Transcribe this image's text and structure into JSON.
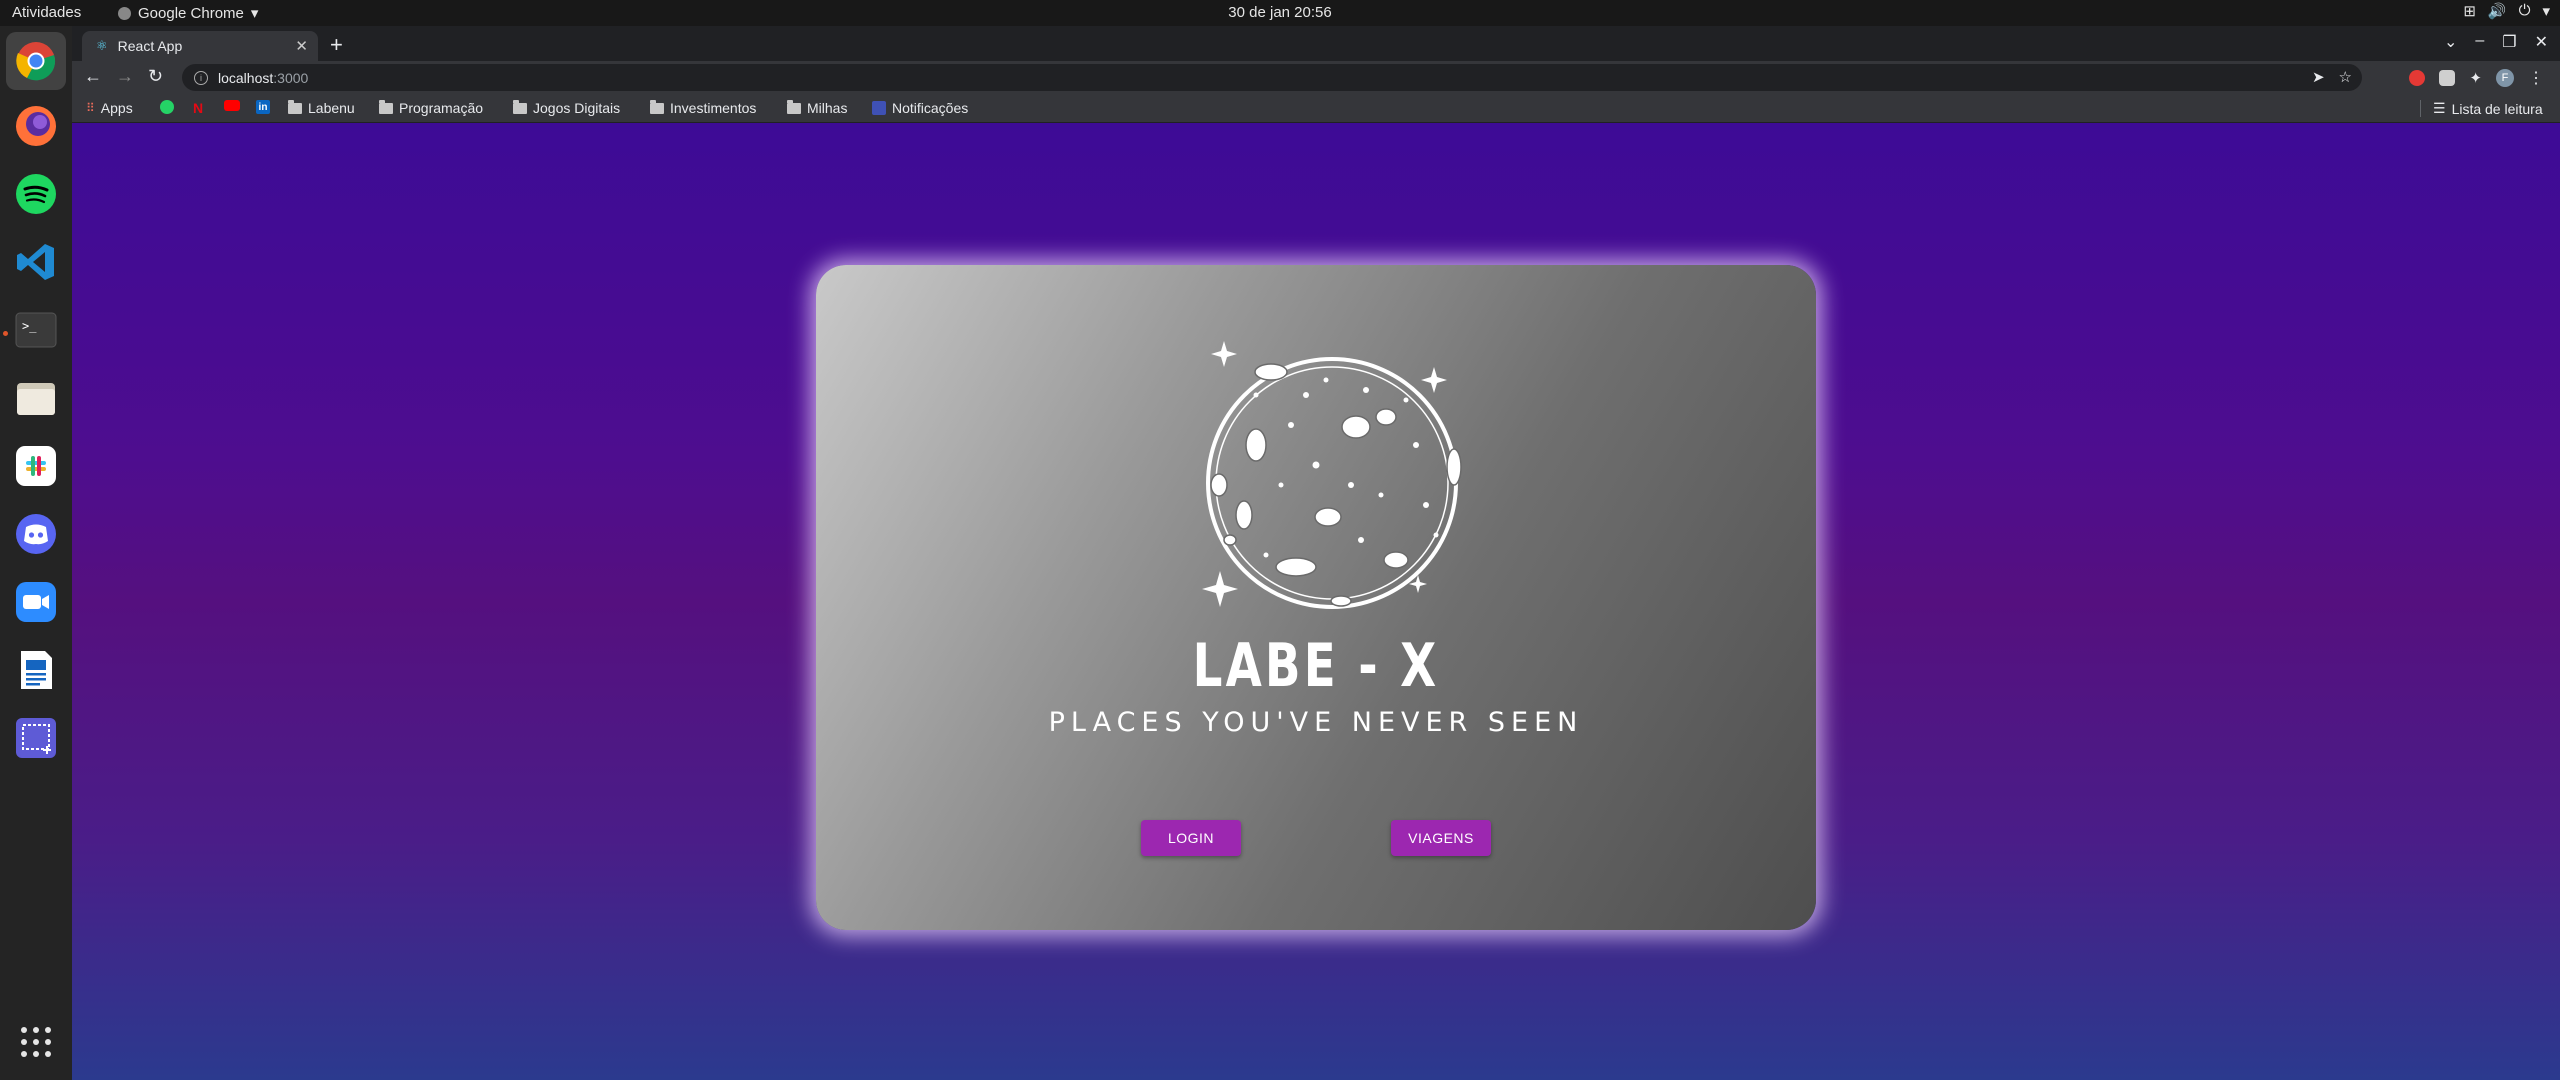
{
  "os": {
    "activities": "Atividades",
    "app_menu": "Google Chrome",
    "clock": "30 de jan  20:56"
  },
  "browser": {
    "tab_title": "React App",
    "url_host": "localhost",
    "url_port": ":3000",
    "bookmarks": [
      {
        "label": "Apps"
      },
      {
        "label": "Labenu"
      },
      {
        "label": "Programação"
      },
      {
        "label": "Jogos Digitais"
      },
      {
        "label": "Investimentos"
      },
      {
        "label": "Milhas"
      },
      {
        "label": "Notificações"
      }
    ],
    "reading_list": "Lista de leitura",
    "profile_initial": "F"
  },
  "page": {
    "brand": "LABE - X",
    "tagline": "PLACES YOU'VE NEVER SEEN",
    "login_button": "LOGIN",
    "trips_button": "VIAGENS"
  },
  "colors": {
    "button": "#9c27b0",
    "bg_top": "#3d0b96",
    "bg_bottom": "#2b3a8e"
  }
}
